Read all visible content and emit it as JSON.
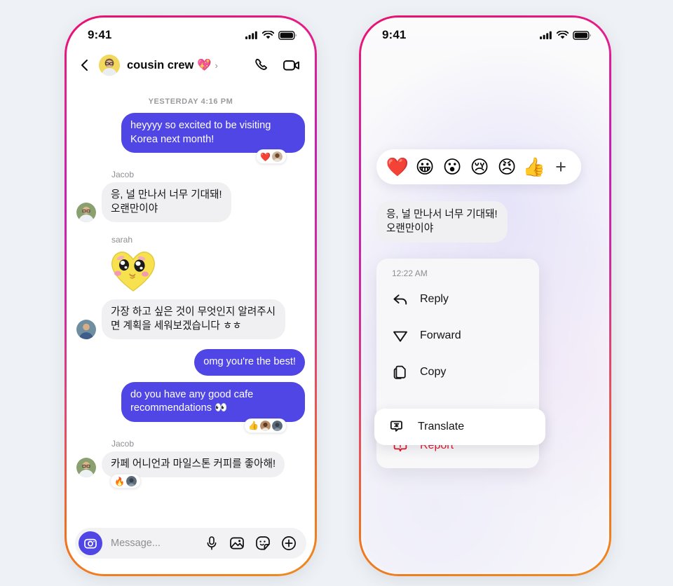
{
  "canvas": {
    "background": "#eef2f6"
  },
  "theme": {
    "bubble_out": "#4f46e5",
    "bubble_in": "#f0f0f2",
    "frame_gradient_from": "#e8106f",
    "frame_gradient_to": "#ee8a22",
    "report_red": "#e0162b",
    "muted_text": "#8e8e93"
  },
  "left_phone": {
    "status": {
      "time": "9:41",
      "cellular": "signal-icon",
      "wifi": "wifi-icon",
      "battery": "battery-icon"
    },
    "header": {
      "back": "chevron-left-icon",
      "avatar": "group-avatar",
      "title": "cousin crew 💖",
      "chevron": "›",
      "call": "phone-icon",
      "video": "video-camera-icon"
    },
    "daystamp": "YESTERDAY 4:16 PM",
    "messages": [
      {
        "id": "m1",
        "dir": "out",
        "text": "heyyyy so excited to be visiting Korea next month!",
        "reactions": [
          "❤️",
          "avatar"
        ]
      },
      {
        "id": "m2",
        "dir": "in",
        "sender": "Jacob",
        "text": "응, 널 만나서 너무 기대돼!\n오랜만이야",
        "reactions": []
      },
      {
        "id": "m3",
        "dir": "in",
        "sender": "sarah",
        "sticker": "yellow-heart-face-sticker",
        "reactions": []
      },
      {
        "id": "m4",
        "dir": "in",
        "text": "가장 하고 싶은 것이 무엇인지 알려주시면 계획을 세워보겠습니다 ㅎㅎ",
        "reactions": []
      },
      {
        "id": "m5",
        "dir": "out",
        "text": "omg you're the best!",
        "reactions": []
      },
      {
        "id": "m6",
        "dir": "out",
        "text": "do you have any good cafe recommendations 👀",
        "reactions": [
          "👍",
          "avatar",
          "avatar"
        ]
      },
      {
        "id": "m7",
        "dir": "in",
        "sender": "Jacob",
        "text": "카페 어니언과 마일스톤 커피를 좋아해!",
        "reactions": [
          "🔥",
          "avatar"
        ]
      }
    ],
    "composer": {
      "camera": "camera-icon",
      "placeholder": "Message...",
      "mic": "microphone-icon",
      "gallery": "image-icon",
      "sticker": "sticker-icon",
      "plus": "plus-circle-icon"
    }
  },
  "right_phone": {
    "status": {
      "time": "9:41",
      "cellular": "signal-icon",
      "wifi": "wifi-icon",
      "battery": "battery-icon"
    },
    "reaction_bar": {
      "emojis": [
        "❤️",
        "😀",
        "😮",
        "😢",
        "😠",
        "👍"
      ],
      "more": "+"
    },
    "focused_message": "응, 널 만나서 너무 기대돼!\n오랜만이야",
    "context_menu": {
      "timestamp": "12:22 AM",
      "items": [
        {
          "label": "Reply",
          "icon": "reply-arrow-icon",
          "selected": false
        },
        {
          "label": "Forward",
          "icon": "forward-paper-plane-icon",
          "selected": false
        },
        {
          "label": "Copy",
          "icon": "copy-documents-icon",
          "selected": false
        },
        {
          "label": "Translate",
          "icon": "translate-icon",
          "selected": true
        },
        {
          "label": "Report",
          "icon": "report-alert-icon",
          "selected": false
        }
      ]
    }
  }
}
